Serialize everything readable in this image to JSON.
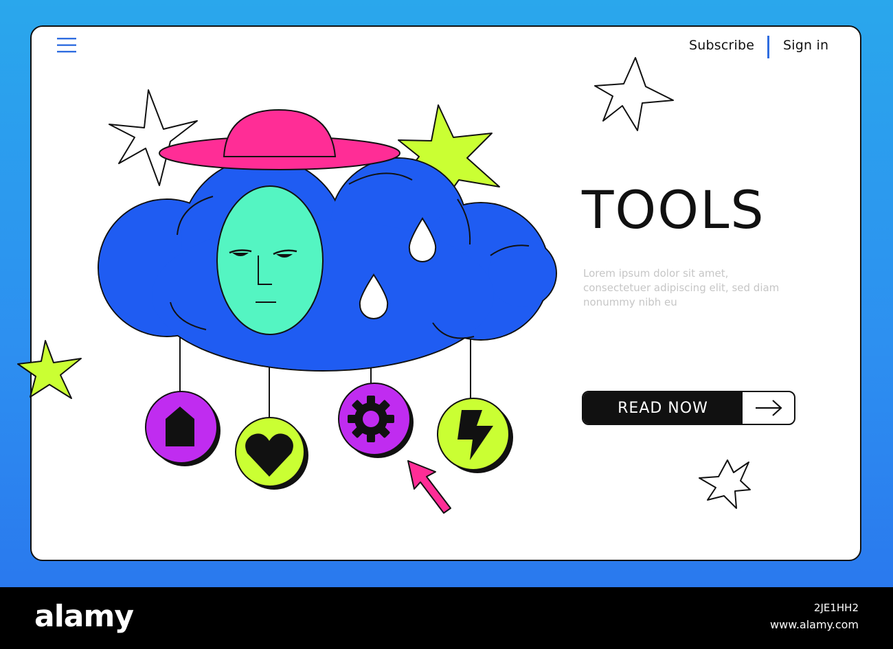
{
  "header": {
    "menu_icon": "hamburger-menu-icon",
    "subscribe_label": "Subscribe",
    "signin_label": "Sign in"
  },
  "hero": {
    "title": "TOOLS",
    "description": "Lorem ipsum dolor sit amet, consectetuer adipiscing elit, sed diam nonummy nibh eu",
    "cta_label": "READ NOW",
    "cta_icon": "arrow-right-icon"
  },
  "illustration": {
    "charms": [
      "home-icon",
      "heart-icon",
      "gear-icon",
      "lightning-icon"
    ],
    "pointer": "cursor-arrow-icon"
  },
  "footer": {
    "logo": "alamy",
    "image_id": "2JE1HH2",
    "site": "www.alamy.com"
  },
  "colors": {
    "background_top": "#2aa7ec",
    "background_bottom": "#2a79ee",
    "cloud": "#1f5cf2",
    "face": "#54f5c2",
    "hat": "#ff2d96",
    "lime": "#caff33",
    "purple": "#c02cf0",
    "accent_divider": "#2f6de0"
  }
}
